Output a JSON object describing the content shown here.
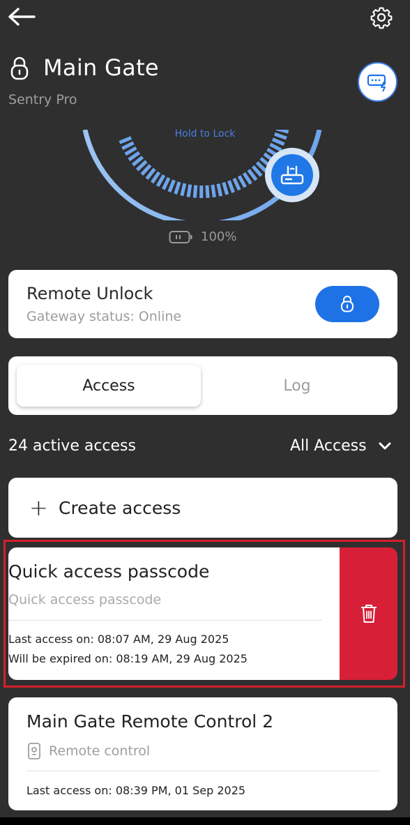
{
  "header": {
    "back_icon": "arrow-left-icon",
    "settings_icon": "gear-icon",
    "title": "Main Gate",
    "subtitle": "Sentry Pro",
    "keypad_icon": "keypad-lightning-icon"
  },
  "dial": {
    "hold_label": "Hold to Lock",
    "knob_icon": "gateway-router-icon",
    "battery_icon": "battery-icon",
    "battery_text": "100%"
  },
  "remote_unlock": {
    "title": "Remote Unlock",
    "status": "Gateway status: Online",
    "button_icon": "lock-icon"
  },
  "tabs": [
    {
      "label": "Access",
      "active": true
    },
    {
      "label": "Log",
      "active": false
    }
  ],
  "access_list": {
    "count_label": "24 active access",
    "filter_label": "All Access",
    "create_label": "Create access",
    "items": [
      {
        "title": "Quick access passcode",
        "type": "Quick access passcode",
        "line1": "Last access on: 08:07 AM, 29 Aug 2025",
        "line2": "Will be expired on: 08:19 AM, 29 Aug 2025",
        "delete_icon": "trash-icon",
        "swiped": true
      },
      {
        "title": "Main Gate Remote Control 2",
        "type": "Remote control",
        "type_icon": "remote-control-icon",
        "line1": "Last access on: 08:39 PM, 01 Sep 2025"
      }
    ]
  },
  "colors": {
    "background": "#2f2f2f",
    "accent": "#1f72e6",
    "delete": "#d71f37",
    "highlight": "#d51f2b"
  }
}
